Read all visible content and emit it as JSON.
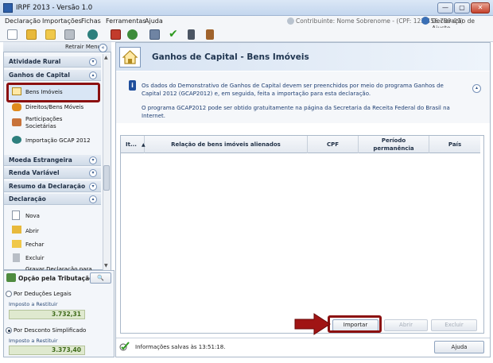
{
  "window": {
    "title": "IRPF 2013 - Versão 1.0",
    "min": "—",
    "max": "▢",
    "close": "✕"
  },
  "menu": [
    "Declaração",
    "Importações",
    "Fichas",
    "Ferramentas",
    "Ajuda"
  ],
  "header_info": {
    "contribuinte": "Contribuinte: Nome Sobrenome - (CPF: 123.456.789-09)",
    "declaracao_ajuste": "Declaração de Ajuste"
  },
  "toolbar_icons": [
    "new-doc-icon",
    "open-folder-icon",
    "folder-icon",
    "trash-icon",
    "transmit-icon",
    "print-red-icon",
    "globe-icon",
    "printer-icon",
    "check-icon",
    "calculator-icon",
    "book-icon"
  ],
  "sidebar": {
    "retrair_label": "Retrair Menu",
    "sections": {
      "atividade_rural": "Atividade Rural",
      "ganhos_capital": "Ganhos de Capital",
      "moeda_estrangeira": "Moeda Estrangeira",
      "renda_variavel": "Renda Variável",
      "resumo": "Resumo da Declaração",
      "declaracao": "Declaração"
    },
    "ganhos_items": {
      "bens_imoveis": "Bens Imóveis",
      "direitos": "Direitos/Bens Móveis",
      "participacoes_1": "Participações",
      "participacoes_2": "Societárias",
      "importacao": "Importação GCAP 2012"
    },
    "declaracao_items": {
      "nova": "Nova",
      "abrir": "Abrir",
      "fechar": "Fechar",
      "excluir": "Excluir",
      "partial": "Gravar Declaração para"
    }
  },
  "opcao": {
    "title": "Opção pela Tributação:",
    "deducoes_label": "Por Deduções Legais",
    "deducoes_sub": "Imposto a Restituir",
    "deducoes_value": "3.732,31",
    "simplificado_label": "Por Desconto Simplificado",
    "simplificado_sub": "Imposto a Restituir",
    "simplificado_value": "3.373,40"
  },
  "main": {
    "title": "Ganhos de Capital - Bens Imóveis",
    "info_line1": "Os dados do Demonstrativo de Ganhos de Capital devem ser preenchidos por meio do programa Ganhos de",
    "info_line2": "Capital 2012 (GCAP2012) e, em seguida, feita a importação para esta declaração.",
    "info_line3": "O programa GCAP2012 pode ser obtido gratuitamente na página da Secretaria da Receita Federal do Brasil na",
    "info_line4": "Internet.",
    "table_headers": {
      "item": "It...",
      "relacao": "Relação de bens imóveis alienados",
      "cpf": "CPF",
      "periodo_1": "Período",
      "periodo_2": "permanência",
      "pais": "País"
    },
    "buttons": {
      "importar": "Importar",
      "abrir": "Abrir",
      "excluir": "Excluir",
      "ajuda": "Ajuda"
    },
    "status": "Informações salvas às 13:51:18."
  },
  "colors": {
    "accent_red": "#8b1010",
    "header_blue": "#1f3550"
  }
}
